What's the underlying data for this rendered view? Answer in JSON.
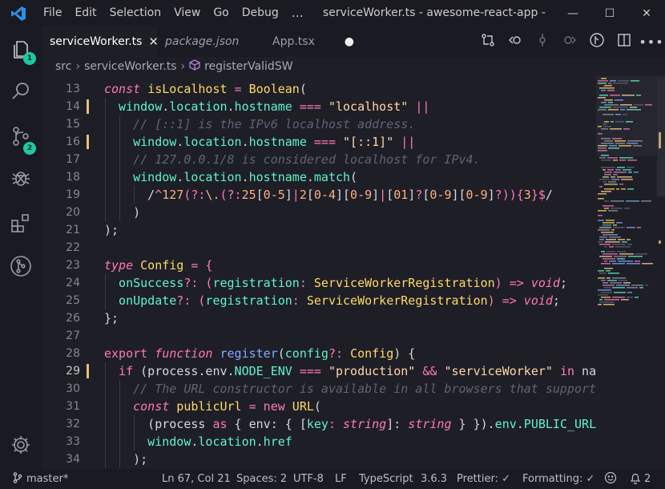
{
  "titlebar": {
    "menu": [
      "File",
      "Edit",
      "Selection",
      "View",
      "Go",
      "Debug"
    ],
    "title": "serviceWorker.ts - awesome-react-app - Visu...",
    "controls": {
      "minimize": "—",
      "maximize": "☐",
      "close": "✕"
    }
  },
  "activitybar": {
    "items": [
      {
        "name": "explorer",
        "icon": "files-icon",
        "badge": "1"
      },
      {
        "name": "search",
        "icon": "search-icon"
      },
      {
        "name": "source-control",
        "icon": "source-control-icon",
        "badge": "2"
      },
      {
        "name": "debug",
        "icon": "bug-icon"
      },
      {
        "name": "extensions",
        "icon": "extensions-icon"
      },
      {
        "name": "git-graph",
        "icon": "git-graph-icon"
      }
    ],
    "settings_icon": "gear-icon"
  },
  "tabs": [
    {
      "label": "serviceWorker.ts",
      "active": true,
      "close": "✕"
    },
    {
      "label": "package.json",
      "italic": true
    },
    {
      "label": "App.tsx",
      "dirty": "●"
    }
  ],
  "breadcrumb": {
    "folder": "src",
    "file": "serviceWorker.ts",
    "symbol": "registerValidSW"
  },
  "editor": {
    "current_line": 29,
    "lines": [
      {
        "n": "13",
        "mod": false
      },
      {
        "n": "14",
        "mod": true
      },
      {
        "n": "15",
        "mod": false
      },
      {
        "n": "16",
        "mod": true
      },
      {
        "n": "17",
        "mod": false
      },
      {
        "n": "18",
        "mod": false
      },
      {
        "n": "19",
        "mod": false
      },
      {
        "n": "20",
        "mod": false
      },
      {
        "n": "21",
        "mod": false
      },
      {
        "n": "22",
        "mod": false
      },
      {
        "n": "23",
        "mod": false
      },
      {
        "n": "24",
        "mod": false
      },
      {
        "n": "25",
        "mod": false
      },
      {
        "n": "26",
        "mod": false
      },
      {
        "n": "27",
        "mod": false
      },
      {
        "n": "28",
        "mod": false
      },
      {
        "n": "29",
        "mod": true
      },
      {
        "n": "30",
        "mod": false
      },
      {
        "n": "31",
        "mod": false
      },
      {
        "n": "32",
        "mod": false
      },
      {
        "n": "33",
        "mod": false
      },
      {
        "n": "34",
        "mod": false
      }
    ],
    "tokens": {
      "l13": [
        "const",
        " ",
        "isLocalhost",
        " = ",
        "Boolean",
        "("
      ],
      "l14": [
        "window",
        ".",
        "location",
        ".",
        "hostname",
        " === ",
        "\"localhost\"",
        " ||"
      ],
      "l15": [
        "// [::1] is the IPv6 localhost address."
      ],
      "l16": [
        "window",
        ".",
        "location",
        ".",
        "hostname",
        " === ",
        "\"[::1]\"",
        " ||"
      ],
      "l17": [
        "// 127.0.0.1/8 is considered localhost for IPv4."
      ],
      "l18": [
        "window",
        ".",
        "location",
        ".",
        "hostname",
        ".",
        "match",
        "("
      ],
      "l19": [
        "/^127(?:\\.(?:25[0-5]|2[0-4][0-9]|[01]?[0-9][0-9]?)){3}$/"
      ],
      "l20": [
        ")"
      ],
      "l21": [
        ");"
      ],
      "l23": [
        "type",
        " ",
        "Config",
        " = {"
      ],
      "l24": [
        "onSuccess",
        "?: (",
        "registration",
        ": ",
        "ServiceWorkerRegistration",
        ") => ",
        "void",
        ";"
      ],
      "l25": [
        "onUpdate",
        "?: (",
        "registration",
        ": ",
        "ServiceWorkerRegistration",
        ") => ",
        "void",
        ";"
      ],
      "l26": [
        "};"
      ],
      "l28": [
        "export",
        " ",
        "function",
        " ",
        "register",
        "(",
        "config",
        "?: ",
        "Config",
        ") {"
      ],
      "l29": [
        "if",
        " (",
        "process",
        ".",
        "env",
        ".",
        "NODE_ENV",
        " === ",
        "\"production\"",
        " && ",
        "\"serviceWorker\"",
        " in ",
        "navig"
      ],
      "l30": [
        "// The URL constructor is available in all browsers that support SW"
      ],
      "l31": [
        "const",
        " ",
        "publicUrl",
        " = ",
        "new",
        " ",
        "URL",
        "("
      ],
      "l32": [
        "(",
        "process",
        " ",
        "as",
        " { ",
        "env",
        ": { [",
        "key",
        ": ",
        "string",
        "]: ",
        "string",
        " } }",
        ").",
        "env",
        ".",
        "PUBLIC_URL",
        ","
      ],
      "l33": [
        "window",
        ".",
        "location",
        ".",
        "href"
      ],
      "l34": [
        ");"
      ]
    }
  },
  "statusbar": {
    "branch": "master*",
    "position": "Ln 67, Col 21",
    "spaces": "Spaces: 2",
    "encoding": "UTF-8",
    "eol": "LF",
    "language": "TypeScript",
    "ts_version": "3.6.3",
    "prettier": "Prettier: ✓",
    "formatting": "Formatting: ✓",
    "notifications": "2"
  },
  "colors": {
    "accent": "#1ec8a0",
    "background": "#1e1e27",
    "chrome": "#1a1a22",
    "modified": "#e5c07b"
  }
}
